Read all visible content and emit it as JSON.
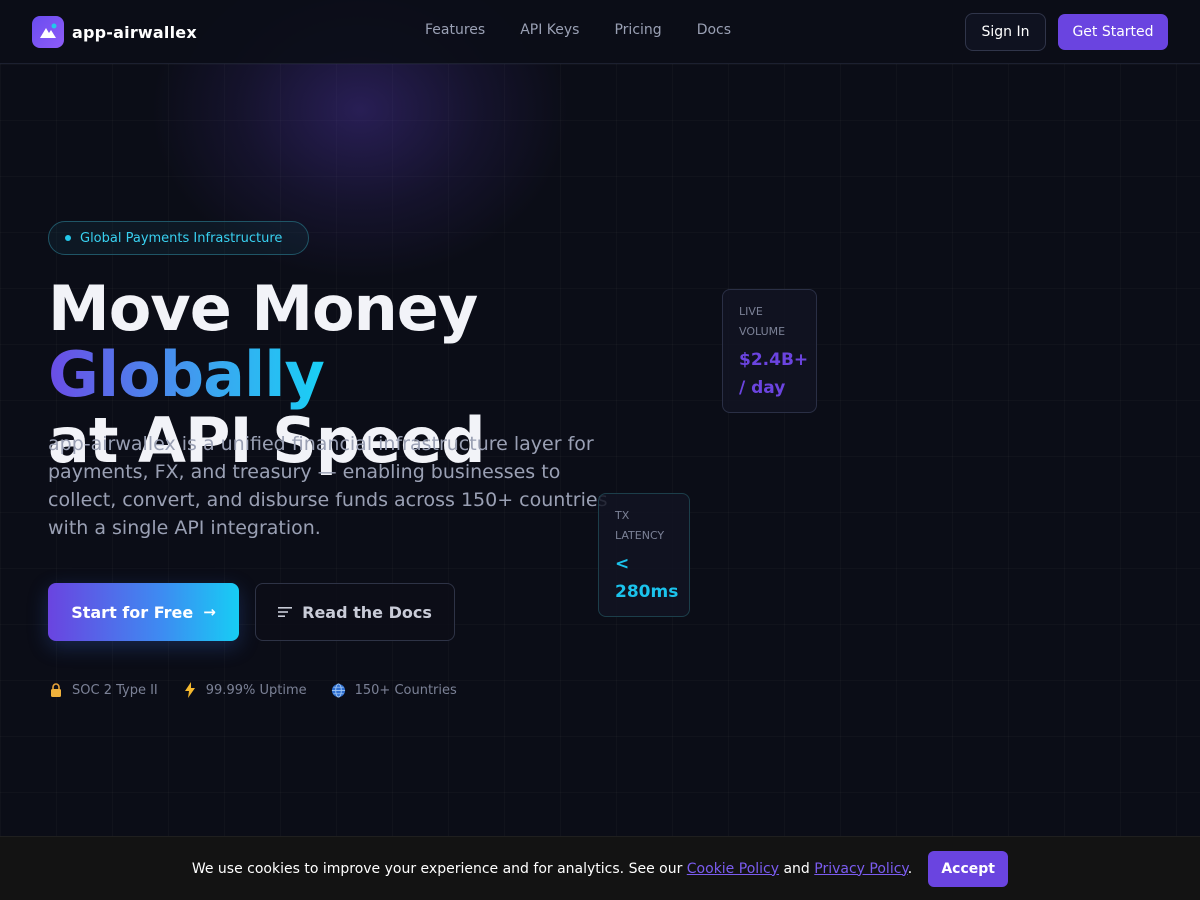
{
  "brand": {
    "name": "app-airwallex",
    "logo_icon": "mountain-logo-icon"
  },
  "nav": {
    "items": [
      "Features",
      "API Keys",
      "Pricing",
      "Docs"
    ]
  },
  "header": {
    "sign_in": "Sign In",
    "get_started": "Get Started"
  },
  "hero": {
    "badge": "Global Payments Infrastructure",
    "headline_part1": "Move Money ",
    "headline_highlight": "Globally",
    "headline_part2": "at API Speed",
    "subtext": "app-airwallex is a unified financial infrastructure layer for payments, FX, and treasury — enabling businesses to collect, convert, and disburse funds across 150+ countries with a single API integration.",
    "cta_primary": "Start for Free",
    "cta_primary_icon": "arrow-right-icon",
    "cta_secondary": "Read the Docs",
    "cta_secondary_icon": "docs-lines-icon"
  },
  "trust": [
    {
      "icon": "lock-icon",
      "label": "SOC 2 Type II"
    },
    {
      "icon": "lightning-icon",
      "label": "99.99% Uptime"
    },
    {
      "icon": "globe-icon",
      "label": "150+ Countries"
    }
  ],
  "stats": {
    "volume": {
      "label_line1": "LIVE",
      "label_line2": "VOLUME",
      "value_line1": "$2.4B+",
      "value_line2": "/ day"
    },
    "latency": {
      "label_line1": "TX",
      "label_line2": "LATENCY",
      "value_line1": "<",
      "value_line2": "280ms"
    }
  },
  "cookie": {
    "text_before": "We use cookies to improve your experience and for analytics. See our ",
    "cookie_link": "Cookie Policy",
    "text_and": " and ",
    "privacy_link": "Privacy Policy",
    "text_after": ".",
    "accept": "Accept"
  },
  "colors": {
    "background": "#0b0d17",
    "accent_purple": "#6a44e0",
    "accent_cyan": "#19d0f5",
    "muted_text": "#9aa0b4"
  }
}
